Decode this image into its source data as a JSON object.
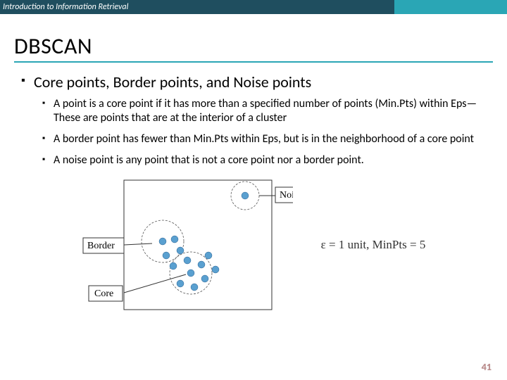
{
  "header": {
    "course": "Introduction to Information Retrieval"
  },
  "title": "DBSCAN",
  "section": "Core points, Border points, and Noise points",
  "bullets": [
    "A point is a core point if it has more than a specified number of points (Min.Pts) within Eps—These are points that are at the interior of a cluster",
    "A border point has fewer than Min.Pts within Eps, but is in the neighborhood of a core point",
    "A noise point is any point that is not a core point nor a border point."
  ],
  "diagram": {
    "labels": {
      "noise": "Noise",
      "border": "Border",
      "core": "Core"
    }
  },
  "formula": "ε = 1 unit, MinPts = 5",
  "page": "41"
}
